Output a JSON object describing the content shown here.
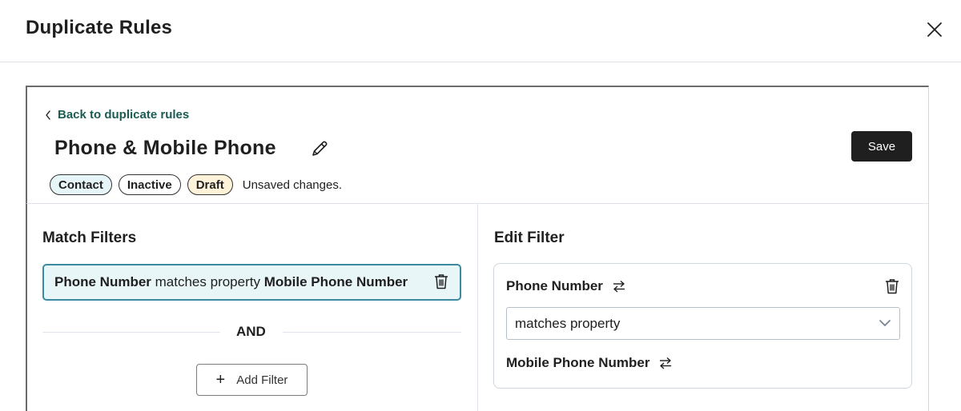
{
  "modal": {
    "title": "Duplicate Rules",
    "close_icon": "close-icon"
  },
  "header": {
    "back_label": "Back to duplicate rules",
    "rule_name": "Phone & Mobile Phone",
    "edit_icon": "pencil-icon",
    "save_label": "Save",
    "tags": {
      "contact": "Contact",
      "inactive": "Inactive",
      "draft": "Draft"
    },
    "status_text": "Unsaved changes."
  },
  "match_filters": {
    "title": "Match Filters",
    "filter": {
      "property": "Phone Number",
      "operator": "matches property",
      "target": "Mobile Phone Number",
      "delete_icon": "trash-icon"
    },
    "and_label": "AND",
    "add_filter_label": "Add Filter"
  },
  "edit_filter": {
    "title": "Edit Filter",
    "property": "Phone Number",
    "operator_selected": "matches property",
    "target": "Mobile Phone Number",
    "swap_icon": "swap-arrows-icon",
    "delete_icon": "trash-icon"
  },
  "colors": {
    "accent_link": "#1a5b52",
    "chip_border": "#3d8aa0",
    "chip_bg": "#e9f6f8",
    "save_bg": "#1f1f1f",
    "tag_contact_bg": "#e5f5f8",
    "tag_draft_bg": "#fef3d8"
  }
}
